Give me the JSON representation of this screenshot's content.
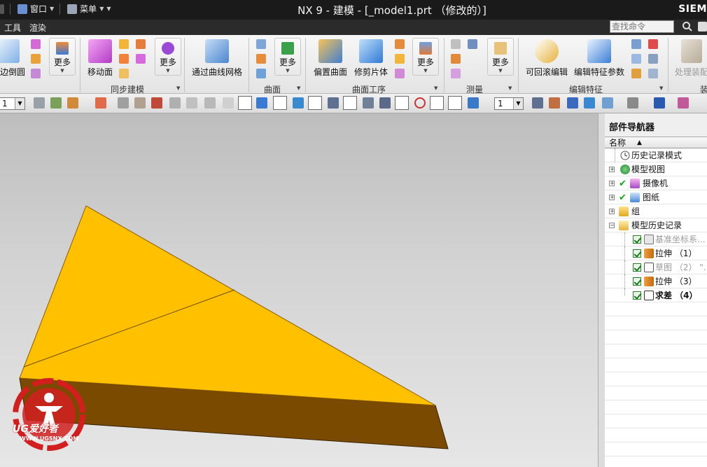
{
  "app": {
    "window_title": "NX 9 - 建模 - [_model1.prt （修改的）]",
    "brand": "SIEM",
    "quick_access": {
      "window_label": "窗口",
      "menu_label": "菜单"
    }
  },
  "menubar": {
    "items": [
      "工具",
      "渲染"
    ],
    "search_placeholder": "查找命令"
  },
  "ribbon": {
    "buttons": {
      "edge_blend": "边倒圆",
      "more": "更多",
      "move_face": "移动面",
      "through_curve_mesh": "通过曲线网格",
      "offset_surface": "偏置曲面",
      "trim_sheet": "修剪片体",
      "rollback_edit": "可回滚编辑",
      "edit_feature_params": "编辑特征参数",
      "process_assembly": "处理装配"
    },
    "groups": {
      "sync_modeling": "同步建模",
      "surface": "曲面",
      "surface_ops": "曲面工序",
      "measure": "测量",
      "edit_feature": "编辑特征",
      "assembly_partial": "装"
    }
  },
  "toolbar": {
    "combo_left": "1",
    "combo_right": "1"
  },
  "navigator": {
    "title": "部件导航器",
    "column_header": "名称",
    "rows": [
      {
        "label": "历史记录模式"
      },
      {
        "label": "模型视图"
      },
      {
        "label": "摄像机"
      },
      {
        "label": "图纸"
      },
      {
        "label": "组"
      },
      {
        "label": "模型历史记录"
      },
      {
        "label": "基准坐标系..."
      },
      {
        "label": "拉伸 （1）"
      },
      {
        "label": "草图 （2） \"..."
      },
      {
        "label": "拉伸 （3）"
      },
      {
        "label": "求差 （4）"
      }
    ]
  },
  "watermark": {
    "title": "UG爱好者",
    "url": "WWW.UGSNX.COM"
  },
  "colors": {
    "model_top": "#FFC000",
    "model_side": "#7A4A00",
    "watermark_red": "#D21E1E"
  }
}
